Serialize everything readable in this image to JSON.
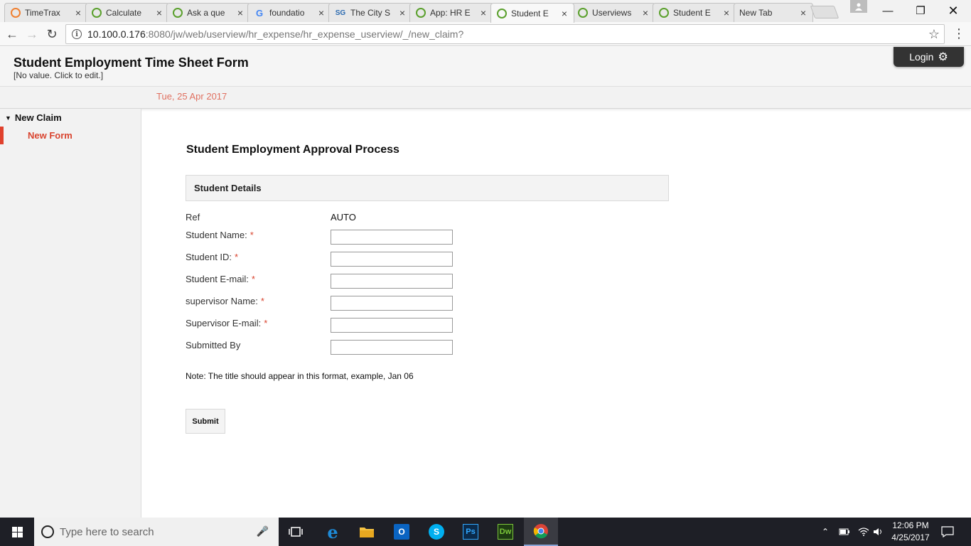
{
  "browser": {
    "tabs": [
      {
        "title": "TimeTrax",
        "icon": "timetrax-icon",
        "color": "#f08030"
      },
      {
        "title": "Calculate",
        "icon": "joget-icon",
        "color": "#5aa02c"
      },
      {
        "title": "Ask a que",
        "icon": "joget-icon",
        "color": "#5aa02c"
      },
      {
        "title": "foundatio",
        "icon": "google-icon",
        "color": "#4285f4"
      },
      {
        "title": "The City S",
        "icon": "city-icon",
        "color": "#2a6ab0"
      },
      {
        "title": "App: HR E",
        "icon": "joget-icon",
        "color": "#5aa02c"
      },
      {
        "title": "Student E",
        "icon": "joget-icon",
        "color": "#5aa02c"
      },
      {
        "title": "Userviews",
        "icon": "joget-icon",
        "color": "#5aa02c"
      },
      {
        "title": "Student E",
        "icon": "joget-icon",
        "color": "#5aa02c"
      },
      {
        "title": "New Tab",
        "icon": "",
        "color": ""
      }
    ],
    "url_host": "10.100.0.176",
    "url_rest": ":8080/jw/web/userview/hr_expense/hr_expense_userview/_/new_claim?"
  },
  "header": {
    "title": "Student Employment Time Sheet Form",
    "subtitle": "[No value. Click to edit.]",
    "login_label": "Login"
  },
  "date_bar": {
    "date": "Tue, 25 Apr 2017"
  },
  "sidebar": {
    "category": "New Claim",
    "items": [
      {
        "label": "New Form"
      }
    ]
  },
  "form": {
    "title": "Student Employment Approval Process",
    "section": "Student Details",
    "fields": [
      {
        "label": "Ref",
        "value": "AUTO",
        "required": false
      },
      {
        "label": "Student Name:",
        "value": "",
        "required": true
      },
      {
        "label": "Student ID:",
        "value": "",
        "required": true
      },
      {
        "label": "Student E-mail:",
        "value": "",
        "required": true
      },
      {
        "label": "supervisor Name:",
        "value": "",
        "required": true
      },
      {
        "label": "Supervisor E-mail:",
        "value": "",
        "required": true
      },
      {
        "label": "Submitted By",
        "value": "",
        "required": false
      }
    ],
    "note": "Note: The title should appear in this format, example, Jan 06",
    "submit_label": "Submit"
  },
  "taskbar": {
    "search_placeholder": "Type here to search",
    "time": "12:06 PM",
    "date": "4/25/2017"
  },
  "colors": {
    "accent_red": "#d9442f",
    "date_text": "#e07060",
    "taskbar_bg": "#1e1f26"
  }
}
